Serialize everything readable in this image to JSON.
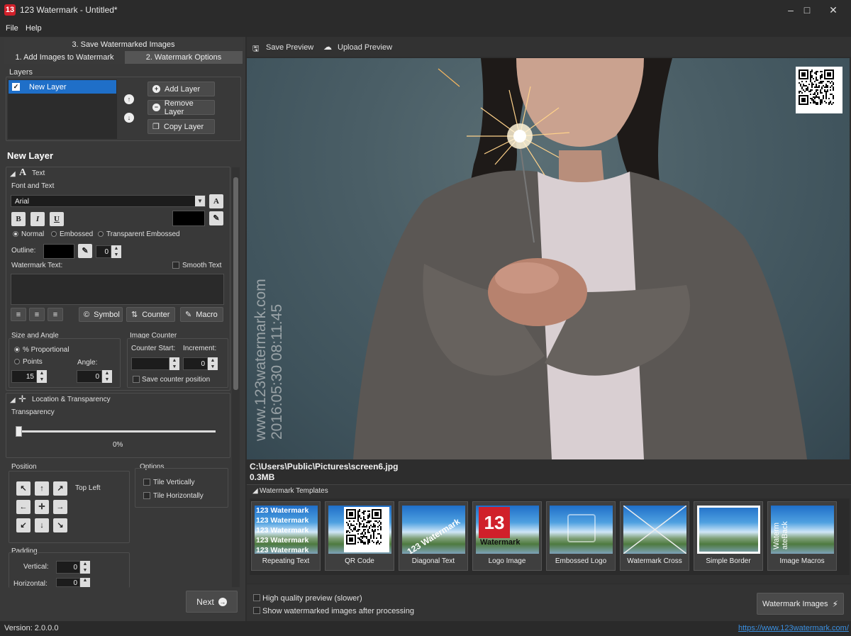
{
  "window": {
    "title": "123 Watermark - Untitled*",
    "app_icon": "13"
  },
  "menu": [
    "File",
    "Help"
  ],
  "steps": {
    "step3": "3. Save Watermarked Images",
    "step1": "1. Add Images to Watermark",
    "step2": "2. Watermark Options"
  },
  "layers": {
    "title": "Layers",
    "items": [
      {
        "label": "New Layer",
        "checked": true
      }
    ],
    "add": "Add Layer",
    "remove": "Remove Layer",
    "copy": "Copy Layer"
  },
  "layer_heading": "New Layer",
  "text_section": {
    "title": "Text",
    "font_group": "Font and Text",
    "font": "Arial",
    "bold": "B",
    "italic": "I",
    "underline": "U",
    "modes": [
      "Normal",
      "Embossed",
      "Transparent Embossed"
    ],
    "selected_mode": "Normal",
    "outline_label": "Outline:",
    "outline_value": "0",
    "watermark_text_label": "Watermark Text:",
    "smooth_text": "Smooth Text",
    "symbol": "Symbol",
    "counter": "Counter",
    "macro": "Macro"
  },
  "size_angle": {
    "title": "Size and Angle",
    "proportional": "% Proportional",
    "points": "Points",
    "angle_label": "Angle:",
    "size_value": "15",
    "angle_value": "0"
  },
  "image_counter": {
    "title": "Image Counter",
    "start_label": "Counter Start:",
    "increment_label": "Increment:",
    "increment_value": "0",
    "save_position": "Save counter position"
  },
  "location": {
    "title": "Location & Transparency",
    "transparency_label": "Transparency",
    "transparency_value": "0%",
    "transparency_fraction": 0,
    "position_title": "Position",
    "position_value": "Top Left",
    "options_title": "Options",
    "tile_vertically": "Tile Vertically",
    "tile_horizontally": "Tile Horizontally",
    "padding_title": "Padding",
    "vertical_label": "Vertical:",
    "horizontal_label": "Horizontal:",
    "vertical_value": "0",
    "horizontal_value": "0"
  },
  "next": "Next",
  "toolbar": {
    "save_preview": "Save Preview",
    "upload_preview": "Upload Preview"
  },
  "preview": {
    "watermark_line1": "www.123watermark.com",
    "watermark_line2": "2016:05:30 08:11:45",
    "path": "C:\\Users\\Public\\Pictures\\screen6.jpg",
    "size": "0.3MB"
  },
  "templates": {
    "title": "Watermark Templates",
    "items": [
      "Repeating Text",
      "QR Code",
      "Diagonal Text",
      "Logo Image",
      "Embossed Logo",
      "Watermark Cross",
      "Simple Border",
      "Image Macros"
    ],
    "repeating_line": "123 Watermark",
    "logo_text": "Watermark",
    "macro_text1": "Waterm",
    "macro_text2": "ateBack",
    "diag_text": "123 Watermark"
  },
  "options": {
    "high_quality": "High quality preview (slower)",
    "show_after": "Show watermarked images after processing",
    "watermark_button": "Watermark Images"
  },
  "status": {
    "version": "Version: 2.0.0.0",
    "url": "https://www.123watermark.com/"
  },
  "colors": {
    "accent": "#1f6fc8",
    "brand": "#d0202a",
    "link": "#3a8fe0"
  }
}
